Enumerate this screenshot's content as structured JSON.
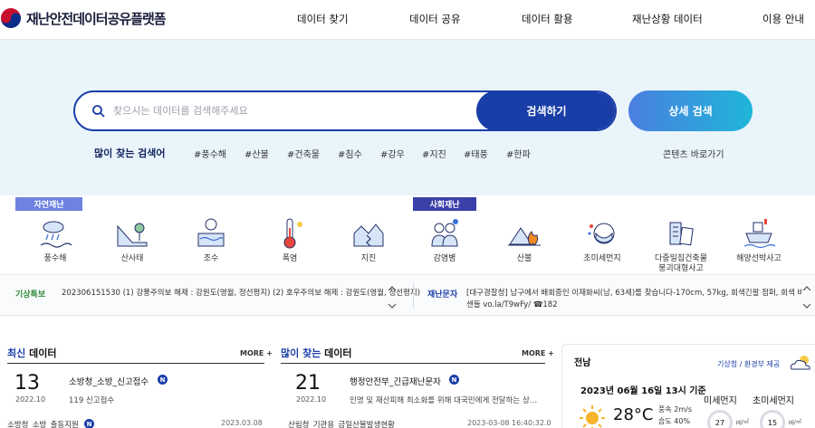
{
  "header": {
    "logo_text": "재난안전데이터공유플랫폼",
    "nav": [
      "데이터 찾기",
      "데이터 공유",
      "데이터 활용",
      "재난상황 데이터",
      "이용 안내"
    ]
  },
  "search": {
    "placeholder": "찾으시는 데이터를 검색해주세요",
    "button_label": "검색하기",
    "advanced_label": "상세 검색",
    "popular_label": "많이 찾는 검색어",
    "tags": [
      "#풍수해",
      "#산불",
      "#건축물",
      "#침수",
      "#강우",
      "#지진",
      "#태풍",
      "#한파"
    ],
    "content_link": "콘텐츠 바로가기"
  },
  "categories": {
    "natural_label": "자연재난",
    "social_label": "사회재난",
    "natural": [
      "풍수해",
      "산사태",
      "조수",
      "폭염",
      "지진"
    ],
    "social": [
      "감염병",
      "산불",
      "초미세먼지",
      "다중밀집건축물\n붕괴대형사고",
      "해양선박사고"
    ]
  },
  "alerts": {
    "weather_tag": "기상특보",
    "weather_text": "202306151530 (1) 강풍주의보 해제 : 강원도(영월, 정선평지) (2) 호우주의보 해제 : 강원도(영월, 정선평지)",
    "disaster_tag": "재난문자",
    "disaster_text_1": "[대구경찰청] 남구에서 배회중인 이재화씨(남, 63세)를 찾습니다-170cm, 57kg, 회색긴팔 점퍼, 회색 바지, 검정",
    "disaster_text_2": "샌들 vo.la/T9wFy/ ☎182"
  },
  "latest": {
    "title_accent": "최신",
    "title_rest": " 데이터",
    "more": "MORE +",
    "day": "13",
    "date": "2022.10",
    "item_title": "소방청_소방_신고접수",
    "item_desc": "119 신고접수",
    "badge": "N",
    "row2_title": "소방청_소방_출동지원",
    "row2_date": "2023.03.08"
  },
  "popular": {
    "title_accent": "많이 찾는",
    "title_rest": " 데이터",
    "more": "MORE +",
    "day": "21",
    "date": "2022.10",
    "item_title": "행정안전부_긴급재난문자",
    "item_desc": "인명 및 재산피해 최소화를 위해 대국민에게 전달하는 상…",
    "badge": "N",
    "row2_title": "산림청_기관용_금일산불발생현황",
    "row2_date": "2023-03-08 16:40:32.0"
  },
  "weather": {
    "region": "전남",
    "source": "기상청 / 환경부 제공",
    "time": "2023년 06월 16일 13시 기준",
    "temp": "28°C",
    "wind": "풍속 2m/s",
    "humidity": "습도 40%",
    "pm10_label": "미세먼지",
    "pm25_label": "초미세먼지",
    "pm10_value": "27",
    "pm25_value": "15",
    "unit": "㎍/㎥"
  },
  "colors": {
    "primary": "#1a3ea8",
    "hero_bg": "#eaf4fb",
    "natural_badge": "#6e82e0",
    "social_badge": "#3b3fa8"
  }
}
